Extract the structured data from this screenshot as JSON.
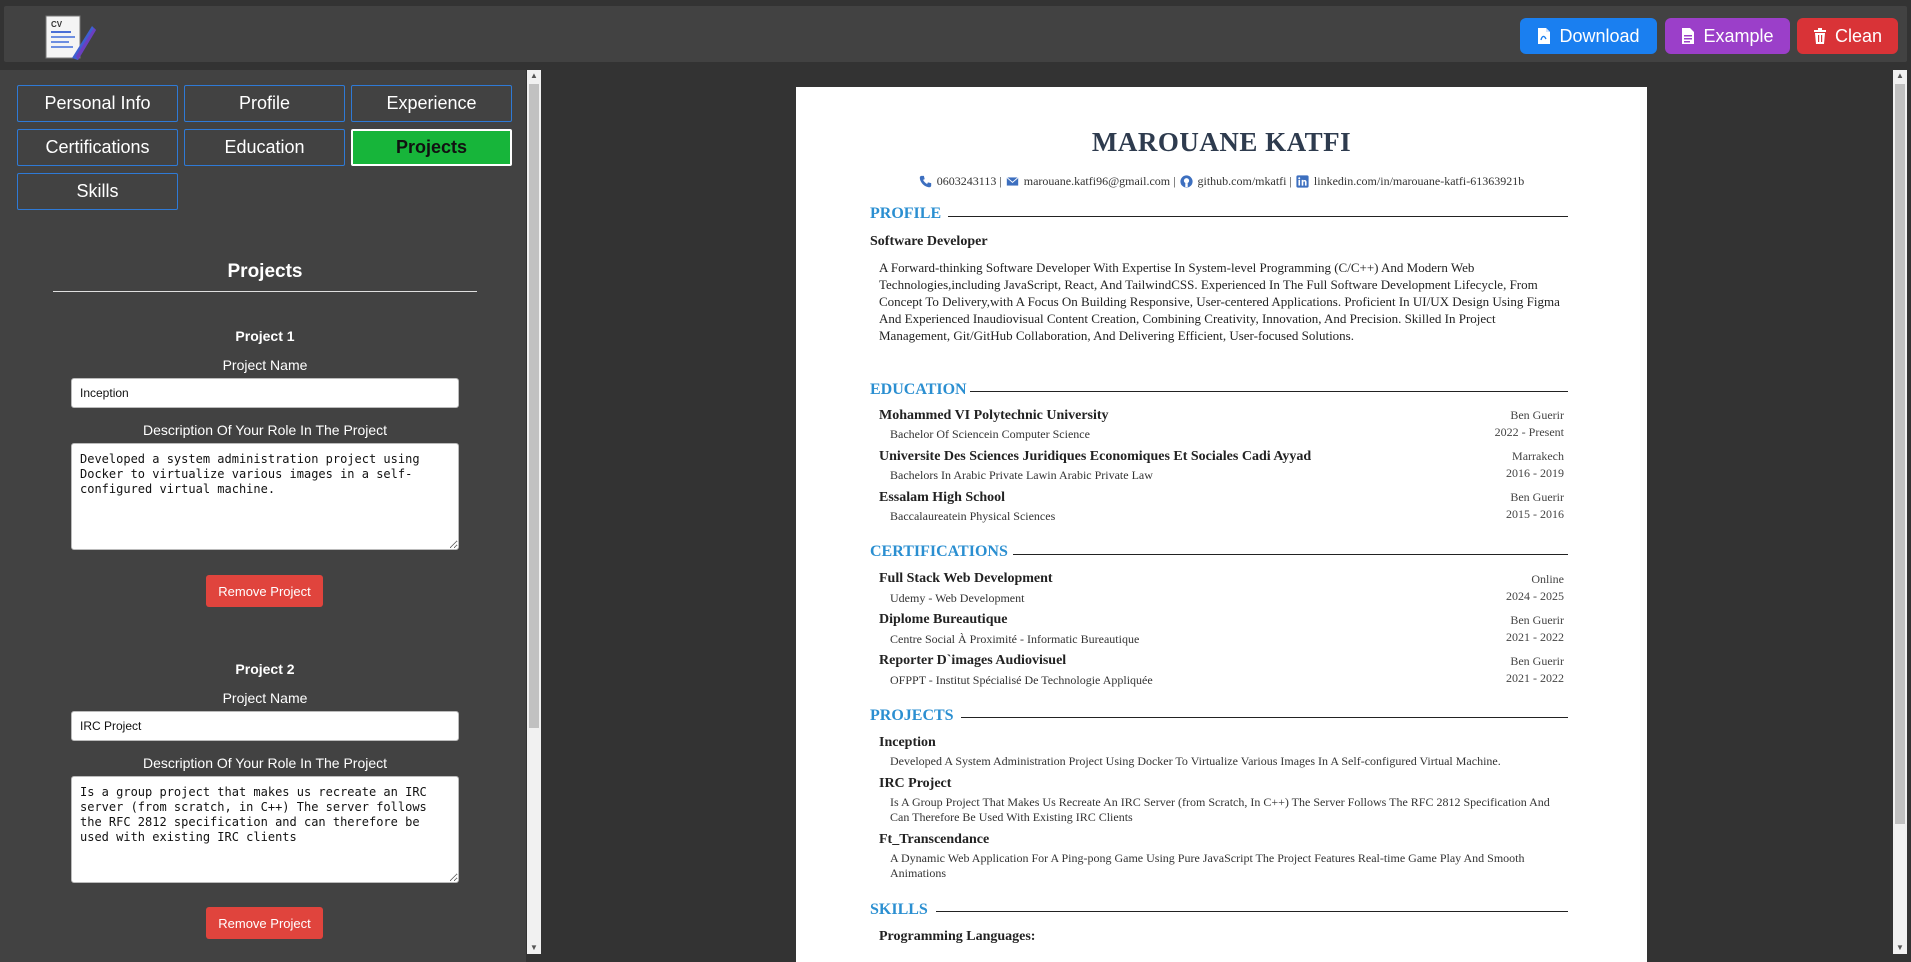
{
  "toolbar": {
    "download_label": "Download",
    "example_label": "Example",
    "clean_label": "Clean",
    "download_color": "#1a7ff0",
    "example_color": "#9b3fc9",
    "clean_color": "#d93337",
    "logo_text": "CV"
  },
  "tabs": [
    {
      "label": "Personal Info"
    },
    {
      "label": "Profile"
    },
    {
      "label": "Experience"
    },
    {
      "label": "Certifications"
    },
    {
      "label": "Education"
    },
    {
      "label": "Projects",
      "active": true
    },
    {
      "label": "Skills"
    }
  ],
  "form": {
    "section_title": "Projects",
    "projects": [
      {
        "heading": "Project 1",
        "name_label": "Project Name",
        "name_value": "Inception",
        "desc_label": "Description Of Your Role In The Project",
        "desc_value": "Developed a system administration project using Docker to virtualize various images in a self-configured virtual machine.",
        "remove_label": "Remove Project"
      },
      {
        "heading": "Project 2",
        "name_label": "Project Name",
        "name_value": "IRC Project",
        "desc_label": "Description Of Your Role In The Project",
        "desc_value": "Is a group project that makes us recreate an IRC server (from scratch, in C++) The server follows the RFC 2812 specification and can therefore be used with existing IRC clients",
        "remove_label": "Remove Project"
      }
    ]
  },
  "resume": {
    "name": "MAROUANE KATFI",
    "contact": {
      "phone": "0603243113 |",
      "email": "marouane.katfi96@gmail.com |",
      "github": "github.com/mkatfi |",
      "linkedin": "linkedin.com/in/marouane-katfi-61363921b"
    },
    "profile": {
      "title": "PROFILE",
      "role": "Software Developer",
      "summary": "A Forward-thinking Software Developer With Expertise In System-level Programming (C/C++) And Modern Web Technologies,including JavaScript, React, And TailwindCSS. Experienced In The Full Software Development Lifecycle, From Concept To Delivery,with A Focus On Building Responsive, User-centered Applications. Proficient In UI/UX Design Using Figma And Experienced Inaudiovisual Content Creation, Combining Creativity, Innovation, And Precision. Skilled In Project Management, Git/GitHub Collaboration, And Delivering Efficient, User-focused Solutions."
    },
    "education": {
      "title": "EDUCATION",
      "items": [
        {
          "school": "Mohammed VI Polytechnic University",
          "degree": "Bachelor Of Sciencein Computer Science",
          "location": "Ben Guerir",
          "dates": "2022 - Present"
        },
        {
          "school": "Universite Des Sciences Juridiques Economiques Et Sociales Cadi Ayyad",
          "degree": "Bachelors In Arabic Private Lawin Arabic Private Law",
          "location": "Marrakech",
          "dates": "2016 - 2019"
        },
        {
          "school": "Essalam High School",
          "degree": "Baccalaureatein Physical Sciences",
          "location": "Ben Guerir",
          "dates": "2015 - 2016"
        }
      ]
    },
    "certifications": {
      "title": "CERTIFICATIONS",
      "items": [
        {
          "name": "Full Stack Web Development",
          "issuer": "Udemy - Web Development",
          "location": "Online",
          "dates": "2024 - 2025"
        },
        {
          "name": "Diplome Bureautique",
          "issuer": "Centre Social À Proximité - Informatic Bureautique",
          "location": "Ben Guerir",
          "dates": "2021 - 2022"
        },
        {
          "name": "Reporter D`images Audiovisuel",
          "issuer": "OFPPT - Institut Spécialisé De Technologie Appliquée",
          "location": "Ben Guerir",
          "dates": "2021 - 2022"
        }
      ]
    },
    "projects": {
      "title": "PROJECTS",
      "items": [
        {
          "name": "Inception",
          "desc": "Developed A System Administration Project Using Docker To Virtualize Various Images In A Self-configured Virtual Machine."
        },
        {
          "name": "IRC Project",
          "desc": "Is A Group Project That Makes Us Recreate An IRC Server (from Scratch, In C++) The Server Follows The RFC 2812 Specification And Can Therefore Be Used With Existing IRC Clients"
        },
        {
          "name": "Ft_Transcendance",
          "desc": "A Dynamic Web Application For A Ping-pong Game Using Pure JavaScript The Project Features Real-time Game Play And Smooth Animations"
        }
      ]
    },
    "skills": {
      "title": "SKILLS",
      "first_category": "Programming Languages:"
    },
    "accent_color": "#2b8fd1"
  }
}
